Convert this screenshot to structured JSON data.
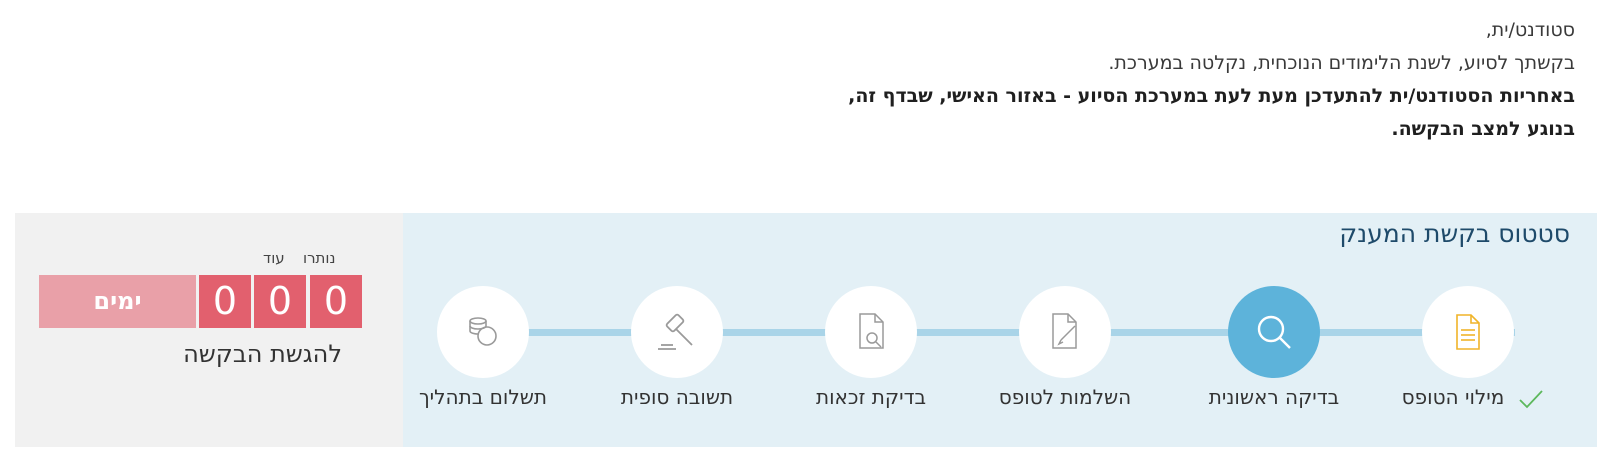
{
  "intro": {
    "line1": "סטודנט/ית,",
    "line2": "בקשתך לסיוע, לשנת הלימודים הנוכחית, נקלטה במערכת.",
    "line3": "באחריות הסטודנט/ית להתעדכן מעת לעת במערכת הסיוע - באזור האישי, שבדף זה,",
    "line4": "בנוגע למצב הבקשה."
  },
  "status": {
    "title": "סטטוס בקשת המענק",
    "steps": [
      {
        "label": "מילוי הטופס",
        "icon": "document-icon",
        "state": "completed"
      },
      {
        "label": "בדיקה ראשונית",
        "icon": "magnifier-icon",
        "state": "active"
      },
      {
        "label": "השלמות לטופס",
        "icon": "document-edit-icon",
        "state": "pending"
      },
      {
        "label": "בדיקת זכאות",
        "icon": "document-search-icon",
        "state": "pending"
      },
      {
        "label": "תשובה סופית",
        "icon": "gavel-icon",
        "state": "pending"
      },
      {
        "label": "תשלום בתהליך",
        "icon": "coins-icon",
        "state": "pending"
      }
    ]
  },
  "countdown": {
    "header_left": "עוד",
    "header_right": "נותרו",
    "digits": [
      "0",
      "0",
      "0"
    ],
    "unit": "ימים",
    "caption": "להגשת הבקשה"
  },
  "colors": {
    "accent_blue": "#5db3da",
    "track": "#a9d4e8",
    "countdown_red": "#e2606e",
    "countdown_pink": "#e9a0a8",
    "completed_doc": "#f0b429",
    "check": "#5cb85c"
  }
}
